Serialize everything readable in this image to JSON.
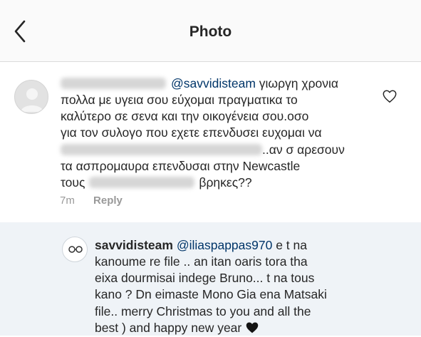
{
  "header": {
    "title": "Photo",
    "back_icon": "chevron-left-icon"
  },
  "comment": {
    "avatar_icon": "default-avatar-icon",
    "mention": "@savvidisteam",
    "line1_text": " γιωργη χρονια",
    "line2": "πολλα με υγεια σου εύχομαι πραγματικα το",
    "line3": "καλύτερο σε σενα και την οικογένεια σου.οσο",
    "line4": "για τον συλογο που εχετε επενδυσει ευχομαι να",
    "line5_text": "..αν σ αρεσουν",
    "line6": "τα ασπρομαυρα επενδυσαι στην Newcastle",
    "line7_prefix": "τους",
    "line7_suffix": "βρηκες??",
    "time": "7m",
    "reply_label": "Reply",
    "like_icon": "heart-outline-icon"
  },
  "reply": {
    "avatar_icon": "glasses-avatar-icon",
    "username": "savvidisteam",
    "mention": "@iliaspappas970",
    "line1_text": " e t na",
    "line2": "kanoume re file .. an itan oaris tora tha",
    "line3": "eixa dourmisai indege Bruno... t na tous",
    "line4": "kano ? Dn eimaste Mono Gia ena Matsaki",
    "line5": "file.. merry Christmas to you and all the",
    "line6_text": "best ) and happy new year",
    "emoji_icon": "black-heart-icon"
  },
  "colors": {
    "header_bg": "#fafafa",
    "reply_bg": "#eff3f7",
    "mention": "#003569",
    "meta": "#999999"
  }
}
